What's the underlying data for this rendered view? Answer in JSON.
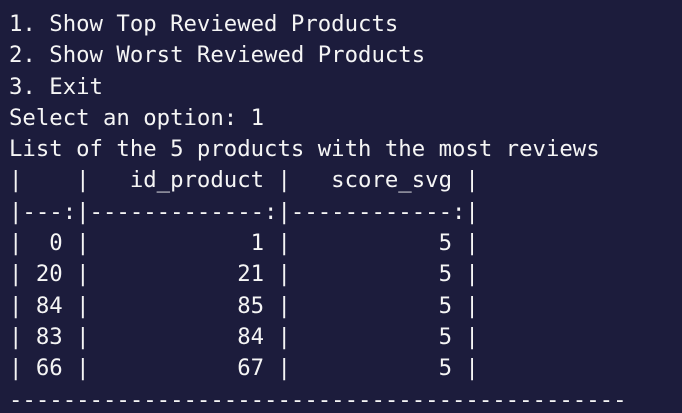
{
  "terminal": {
    "lines": [
      "1. Show Top Reviewed Products",
      "2. Show Worst Reviewed Products",
      "3. Exit",
      "Select an option: 1",
      "List of the 5 products with the most reviews",
      "|    |   id_product |   score_svg |",
      "|---:|-------------:|------------:|",
      "|  0 |            1 |           5 |",
      "| 20 |           21 |           5 |",
      "| 84 |           85 |           5 |",
      "| 83 |           84 |           5 |",
      "| 66 |           67 |           5 |",
      "----------------------------------------------"
    ]
  },
  "colors": {
    "background": "#1c1c3c",
    "text": "#f5f5f5"
  }
}
